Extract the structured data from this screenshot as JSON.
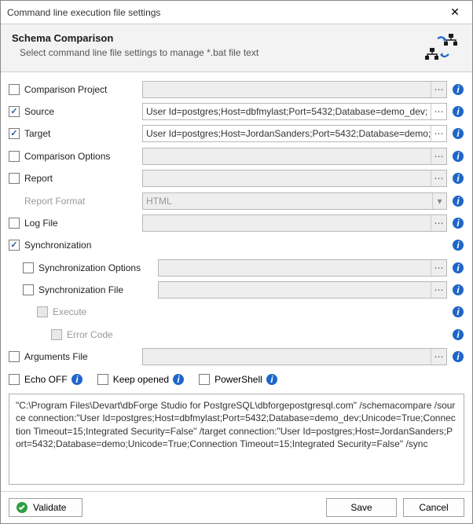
{
  "window": {
    "title": "Command line execution file settings"
  },
  "header": {
    "title": "Schema Comparison",
    "subtitle": "Select command line file settings to manage *.bat file text"
  },
  "rows": {
    "comparisonProject": {
      "label": "Comparison Project",
      "value": ""
    },
    "source": {
      "label": "Source",
      "value": "User Id=postgres;Host=dbfmylast;Port=5432;Database=demo_dev;"
    },
    "target": {
      "label": "Target",
      "value": "User Id=postgres;Host=JordanSanders;Port=5432;Database=demo;"
    },
    "comparisonOptions": {
      "label": "Comparison Options",
      "value": ""
    },
    "report": {
      "label": "Report",
      "value": ""
    },
    "reportFormat": {
      "label": "Report Format",
      "value": "HTML"
    },
    "logFile": {
      "label": "Log File",
      "value": ""
    },
    "synchronization": {
      "label": "Synchronization"
    },
    "syncOptions": {
      "label": "Synchronization Options",
      "value": ""
    },
    "syncFile": {
      "label": "Synchronization File",
      "value": ""
    },
    "execute": {
      "label": "Execute"
    },
    "errorCode": {
      "label": "Error Code"
    },
    "argumentsFile": {
      "label": "Arguments File",
      "value": ""
    }
  },
  "opts": {
    "echoOff": "Echo OFF",
    "keepOpened": "Keep opened",
    "powershell": "PowerShell"
  },
  "command": "\"C:\\Program Files\\Devart\\dbForge Studio for PostgreSQL\\dbforgepostgresql.com\" /schemacompare /source connection:\"User Id=postgres;Host=dbfmylast;Port=5432;Database=demo_dev;Unicode=True;Connection Timeout=15;Integrated Security=False\" /target connection:\"User Id=postgres;Host=JordanSanders;Port=5432;Database=demo;Unicode=True;Connection Timeout=15;Integrated Security=False\" /sync",
  "footer": {
    "validate": "Validate",
    "save": "Save",
    "cancel": "Cancel"
  },
  "colors": {
    "info": "#1e66c8",
    "check": "#2a5a9a",
    "validate": "#2e9e3f"
  }
}
